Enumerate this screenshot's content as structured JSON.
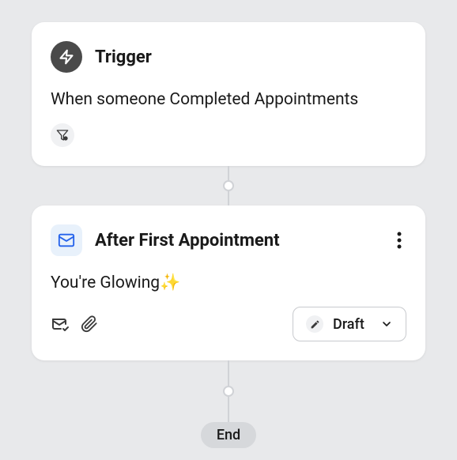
{
  "trigger": {
    "title": "Trigger",
    "description": "When someone Completed Appointments"
  },
  "action": {
    "title": "After First Appointment",
    "body": "You're Glowing✨",
    "status": "Draft"
  },
  "end": {
    "label": "End"
  }
}
